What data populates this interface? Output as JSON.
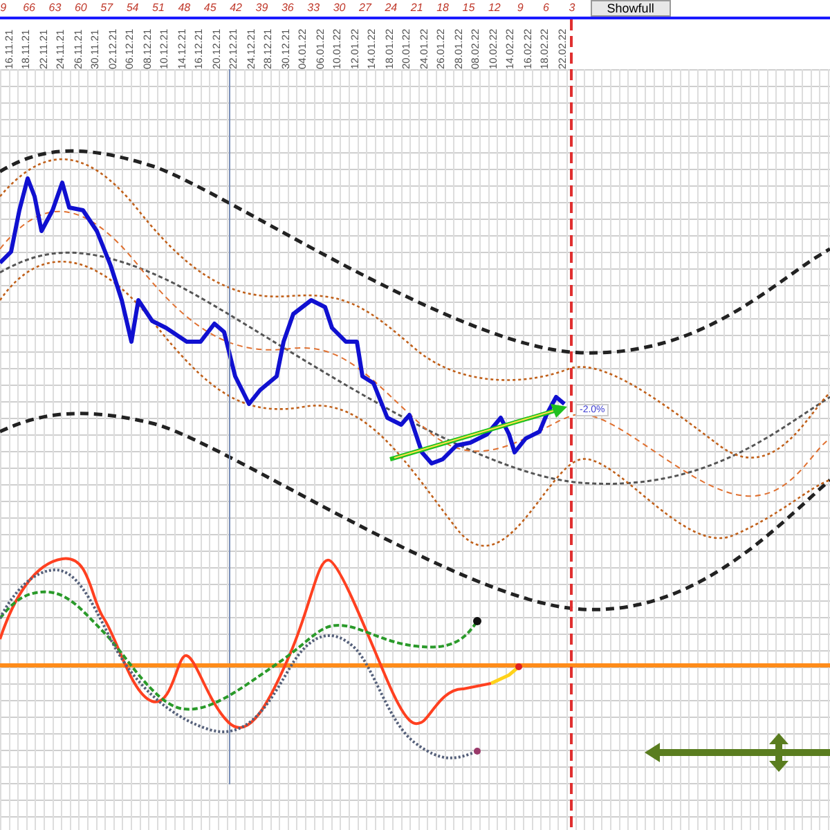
{
  "cycle_axis": {
    "labels": [
      "9",
      "66",
      "63",
      "60",
      "57",
      "54",
      "51",
      "48",
      "45",
      "42",
      "39",
      "36",
      "33",
      "30",
      "27",
      "24",
      "21",
      "18",
      "15",
      "12",
      "9",
      "6",
      "3"
    ]
  },
  "toolbar": {
    "button": "Showfull"
  },
  "date_axis": {
    "labels": [
      "16.11.21",
      "18.11.21",
      "22.11.21",
      "24.11.21",
      "26.11.21",
      "30.11.21",
      "02.12.21",
      "06.12.21",
      "08.12.21",
      "10.12.21",
      "14.12.21",
      "16.12.21",
      "20.12.21",
      "22.12.21",
      "24.12.21",
      "28.12.21",
      "30.12.21",
      "04.01.22",
      "06.01.22",
      "10.01.22",
      "12.01.22",
      "14.01.22",
      "18.01.22",
      "20.01.22",
      "24.01.22",
      "26.01.22",
      "28.01.22",
      "08.02.22",
      "10.02.22",
      "14.02.22",
      "16.02.22",
      "18.02.22",
      "22.02.22"
    ]
  },
  "chart": {
    "trend_label": "-2.0%"
  }
}
